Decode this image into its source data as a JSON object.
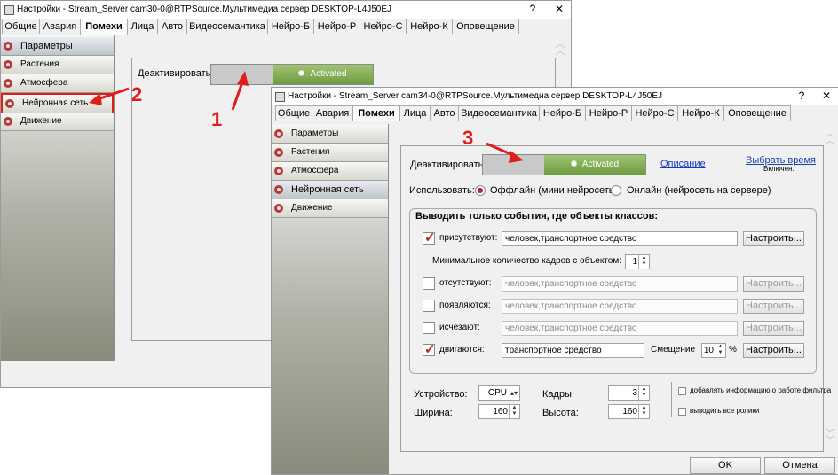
{
  "back_window": {
    "title": "Настройки - Stream_Server cam30-0@RTPSource.Мультимедиа сервер DESKTOP-L4J50EJ",
    "tabs": [
      "Общие",
      "Авария",
      "Помехи",
      "Лица",
      "Авто",
      "Видеосемантика",
      "Нейро-Б",
      "Нейро-Р",
      "Нейро-С",
      "Нейро-К",
      "Оповещение"
    ],
    "active_tab": "Помехи",
    "nav": [
      "Параметры",
      "Растения",
      "Атмосфера",
      "Нейронная сеть",
      "Движение"
    ],
    "deactivate_label": "Деактивировать",
    "toggle_state": "Activated",
    "help_btn": "?",
    "close_btn": "✕"
  },
  "front_window": {
    "title": "Настройки - Stream_Server cam34-0@RTPSource.Мультимедиа сервер DESKTOP-L4J50EJ",
    "tabs": [
      "Общие",
      "Авария",
      "Помехи",
      "Лица",
      "Авто",
      "Видеосемантика",
      "Нейро-Б",
      "Нейро-Р",
      "Нейро-С",
      "Нейро-К",
      "Оповещение"
    ],
    "active_tab": "Помехи",
    "nav": [
      "Параметры",
      "Растения",
      "Атмосфера",
      "Нейронная сеть",
      "Движение"
    ],
    "deactivate_label": "Деактивировать",
    "toggle_state": "Activated",
    "description_link": "Описание",
    "choose_time_link": "Выбрать время",
    "choose_time_status": "Включен.",
    "use_label": "Использовать:",
    "offline_option": "Оффлайн (мини нейросеть)",
    "online_option": "Онлайн (нейросеть на сервере)",
    "group_title": "Выводить только события, где объекты классов:",
    "present_label": "присутствуют:",
    "present_value": "человек,транспортное средство",
    "min_frames_label": "Минимальное количество кадров с объектом:",
    "min_frames_value": "1",
    "absent_label": "отсутствуют:",
    "absent_value": "человек,транспортное средство",
    "appear_label": "появляются:",
    "appear_value": "человек,транспортное средство",
    "disappear_label": "исчезают:",
    "disappear_value": "человек,транспортное средство",
    "move_label": "двигаются:",
    "move_value": "транспортное средство",
    "offset_label": "Смещение",
    "offset_value": "10",
    "offset_unit": "%",
    "configure_btn": "Настроить...",
    "device_label": "Устройство:",
    "device_value": "CPU",
    "frames_label": "Кадры:",
    "frames_value": "3",
    "width_label": "Ширина:",
    "width_value": "160",
    "height_label": "Высота:",
    "height_value": "160",
    "add_info_label": "добавлять информацию о работе фильтра",
    "show_all_label": "выводить все ролики",
    "ok_btn": "OK",
    "cancel_btn": "Отмена",
    "help_btn": "?",
    "close_btn": "✕"
  },
  "annotations": [
    "1",
    "2",
    "3"
  ],
  "colors": {
    "annotation": "#e01d1d",
    "toggle_on": "#7aa84a",
    "link": "#1a3ab7"
  }
}
